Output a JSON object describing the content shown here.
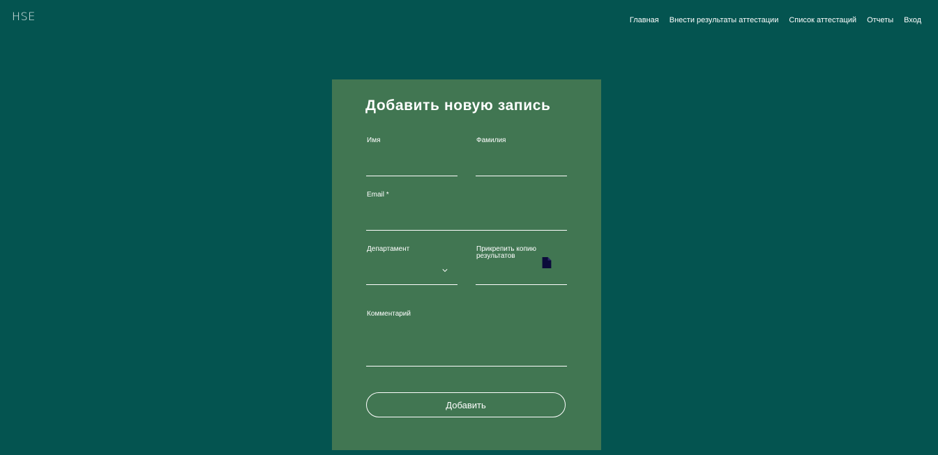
{
  "header": {
    "logo": "HSE",
    "nav": [
      {
        "label": "Главная"
      },
      {
        "label": "Внести результаты аттестации"
      },
      {
        "label": "Список аттестаций"
      },
      {
        "label": "Отчеты"
      },
      {
        "label": "Вход"
      }
    ]
  },
  "form": {
    "title": "Добавить новую запись",
    "first_name": {
      "label": "Имя",
      "value": ""
    },
    "last_name": {
      "label": "Фамилия",
      "value": ""
    },
    "email": {
      "label": "Email *",
      "value": ""
    },
    "department": {
      "label": "Департамент",
      "selected": ""
    },
    "attachment": {
      "label": "Прикрепить копию результатов",
      "icon": "file-icon"
    },
    "comment": {
      "label": "Комментарий",
      "value": ""
    },
    "submit_label": "Добавить"
  },
  "colors": {
    "background": "#045450",
    "card": "#417652",
    "icon": "#0b0b3a"
  }
}
